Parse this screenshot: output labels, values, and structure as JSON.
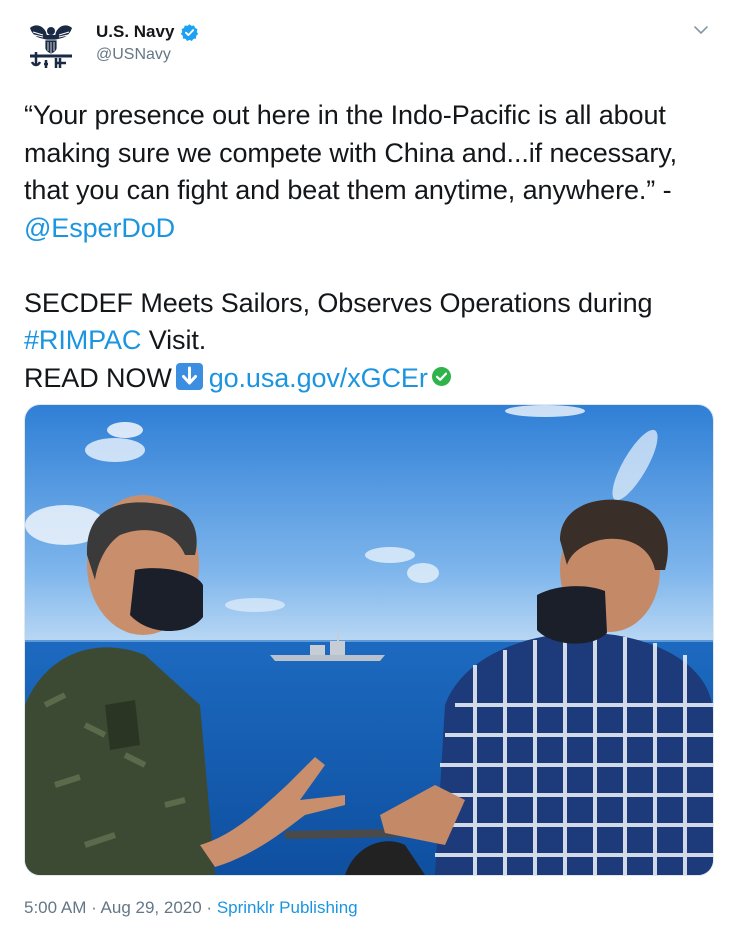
{
  "account": {
    "display_name": "U.S. Navy",
    "handle": "@USNavy"
  },
  "tweet": {
    "lines": [
      "“Your presence out here in the Indo-Pacific is all about",
      "making sure we compete with China and...if necessary,",
      "that you can fight and beat them anytime, anywhere.” -"
    ],
    "mention": "@EsperDoD",
    "headline_line1": "SECDEF Meets Sailors, Observes Operations during",
    "hashtag": "#RIMPAC",
    "hashtag_suffix": " Visit.",
    "read_now": "READ NOW",
    "link": "go.usa.gov/xGCEr"
  },
  "meta": {
    "time": "5:00 AM",
    "separator": " · ",
    "date": "Aug 29, 2020",
    "source": "Sprinklr Publishing"
  },
  "icons": {
    "verified": "verified-badge-icon",
    "caret": "chevron-down-icon",
    "download": "down-arrow-icon",
    "check": "check-circle-icon"
  },
  "colors": {
    "link": "#1b95e0",
    "text": "#14171a",
    "muted": "#657786"
  }
}
